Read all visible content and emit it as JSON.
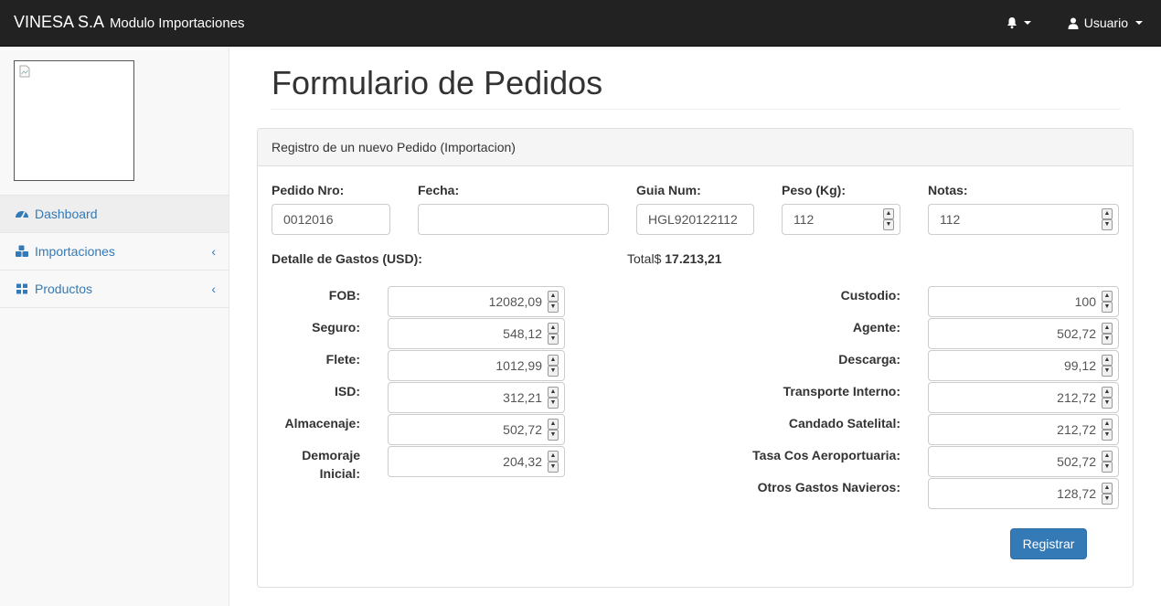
{
  "navbar": {
    "brand_main": "VINESA S.A",
    "brand_sub": "Modulo Importaciones",
    "user_label": "Usuario"
  },
  "sidebar": {
    "items": [
      {
        "label": "Dashboard",
        "icon": "dashboard-icon"
      },
      {
        "label": "Importaciones",
        "icon": "cubes-icon"
      },
      {
        "label": "Productos",
        "icon": "grid-icon"
      }
    ]
  },
  "page": {
    "title": "Formulario de Pedidos",
    "panel_heading": "Registro de un nuevo Pedido (Importacion)"
  },
  "form": {
    "pedido_label": "Pedido Nro:",
    "pedido_value": "0012016",
    "fecha_label": "Fecha:",
    "fecha_value": "",
    "guia_label": "Guia Num:",
    "guia_value": "HGL920122112",
    "peso_label": "Peso (Kg):",
    "peso_value": "112",
    "notas_label": "Notas:",
    "notas_value": "112",
    "detalle_label": "Detalle de Gastos (USD):",
    "total_prefix": "Total$",
    "total_value": "17.213,21"
  },
  "gastos_left": [
    {
      "label": "FOB:",
      "value": "12082,09"
    },
    {
      "label": "Seguro:",
      "value": "548,12"
    },
    {
      "label": "Flete:",
      "value": "1012,99"
    },
    {
      "label": "ISD:",
      "value": "312,21"
    },
    {
      "label": "Almacenaje:",
      "value": "502,72"
    },
    {
      "label": "Demoraje",
      "label2": "Inicial:",
      "value": "204,32"
    }
  ],
  "gastos_right": [
    {
      "label": "Custodio:",
      "value": "100"
    },
    {
      "label": "Agente:",
      "value": "502,72"
    },
    {
      "label": "Descarga:",
      "value": "99,12"
    },
    {
      "label": "Transporte Interno:",
      "value": "212,72"
    },
    {
      "label": "Candado Satelital:",
      "value": "212,72"
    },
    {
      "label": "Tasa Cos Aeroportuaria:",
      "value": "502,72"
    },
    {
      "label": "Otros Gastos Navieros:",
      "value": "128,72"
    }
  ],
  "actions": {
    "submit_label": "Registrar"
  },
  "colors": {
    "navbar_bg": "#222222",
    "link": "#337ab7",
    "primary": "#337ab7"
  }
}
